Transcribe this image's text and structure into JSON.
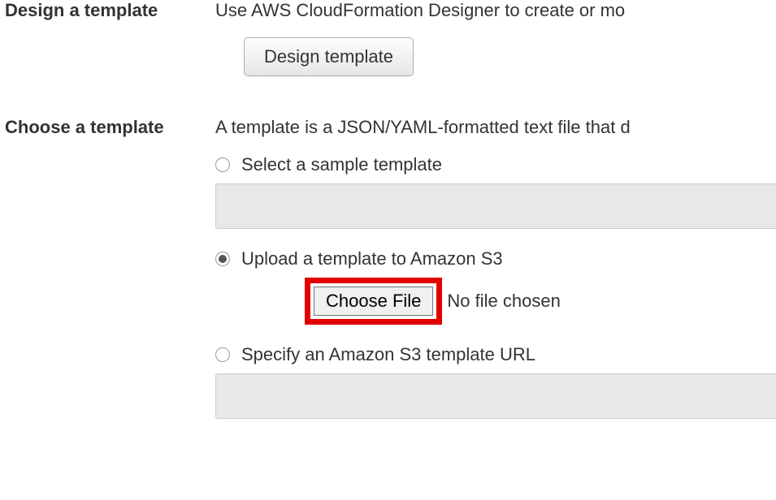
{
  "design": {
    "label": "Design a template",
    "description": "Use AWS CloudFormation Designer to create or mo",
    "button": "Design template"
  },
  "choose": {
    "label": "Choose a template",
    "description": "A template is a JSON/YAML-formatted text file that d",
    "options": {
      "sample": "Select a sample template",
      "upload": "Upload a template to Amazon S3",
      "url": "Specify an Amazon S3 template URL"
    },
    "file": {
      "button": "Choose File",
      "status": "No file chosen"
    }
  }
}
